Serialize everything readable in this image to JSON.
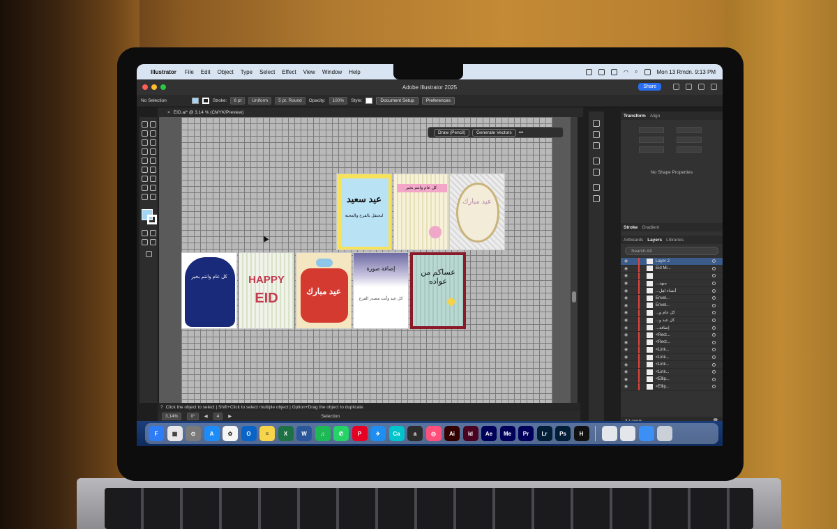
{
  "menubar": {
    "app_name": "Illustrator",
    "menus": [
      "File",
      "Edit",
      "Object",
      "Type",
      "Select",
      "Effect",
      "View",
      "Window",
      "Help"
    ],
    "datetime": "Mon 13 Rmdn. 9:13 PM"
  },
  "window": {
    "title": "Adobe Illustrator 2025",
    "share_label": "Share"
  },
  "control_bar": {
    "selection": "No Selection",
    "stroke_label": "Stroke:",
    "stroke_value": "6 pt",
    "profile": "Uniform",
    "brush": "5 pt. Round",
    "opacity_label": "Opacity:",
    "opacity_value": "100%",
    "style_label": "Style:",
    "document_setup": "Document Setup",
    "preferences": "Preferences",
    "fill_color": "#a3d4f3"
  },
  "document_tab": "EID.ai* @ 3.14 % (CMYK/Preview)",
  "context_bar": {
    "draw": "Draw (Pencil)",
    "generate": "Generate Vectors",
    "more": "•••"
  },
  "cards": {
    "c1": "عيد سعيد",
    "c1_sub": "لنحتفل بالفرح والمحبة",
    "c2": "كل عام وانتم بخير",
    "c3": "عيد مبارك",
    "c4": "كل عام وانتم بخير",
    "c5_line1": "HAPPY",
    "c5_line2": "EID",
    "c6": "عيد مبارك",
    "c7": "إضافة صورة",
    "c7_sub": "كل عيد وأنت مصدر الفرح",
    "c8": "عساكم من عواده"
  },
  "hint": "Click the object to select | Shift+Click to select multiple object | Option+Drag the object to duplicate",
  "status": {
    "zoom": "3.14%",
    "rotation": "0°",
    "artboard": "4",
    "mode": "Selection"
  },
  "right_panel": {
    "tabs_top": [
      "Transform",
      "Align"
    ],
    "no_shape": "No Shape Properties",
    "tabs_mid": [
      "Stroke",
      "Gradient"
    ],
    "tabs_layers": [
      "Artboards",
      "Layers",
      "Libraries"
    ],
    "search_placeholder": "Search All",
    "layers": [
      "Layer 2",
      "Eid Mi...",
      "",
      "...مبهد",
      "...أنشاء اهل",
      "Envel...",
      "Envel...",
      "...كل عام و",
      "...كل عيد و",
      "...إضافة",
      "<Rect...",
      "<Rect...",
      "<Link...",
      "<Link...",
      "<Link...",
      "<Link...",
      "<Ellip...",
      "<Ellip..."
    ],
    "footer": "3 Layers"
  },
  "dock": {
    "apps": [
      {
        "label": "F",
        "color": "#2e7cf6"
      },
      {
        "label": "▦",
        "color": "#e8e8ea"
      },
      {
        "label": "⊙",
        "color": "#7a7a7a"
      },
      {
        "label": "A",
        "color": "#1d8cf8"
      },
      {
        "label": "✿",
        "color": "#f5f5f5"
      },
      {
        "label": "O",
        "color": "#0a64c8"
      },
      {
        "label": "≡",
        "color": "#f7d54a"
      },
      {
        "label": "X",
        "color": "#1e7145"
      },
      {
        "label": "W",
        "color": "#2b579a"
      },
      {
        "label": "♫",
        "color": "#1db954"
      },
      {
        "label": "✆",
        "color": "#25d366"
      },
      {
        "label": "P",
        "color": "#e60023"
      },
      {
        "label": "✈",
        "color": "#1f8ef1"
      },
      {
        "label": "Ca",
        "color": "#00c4cc"
      },
      {
        "label": "a",
        "color": "#2d2d2d"
      },
      {
        "label": "◎",
        "color": "#ff4f7b"
      },
      {
        "label": "Ai",
        "color": "#330000"
      },
      {
        "label": "Id",
        "color": "#49021f"
      },
      {
        "label": "Ae",
        "color": "#00005b"
      },
      {
        "label": "Me",
        "color": "#00005b"
      },
      {
        "label": "Pr",
        "color": "#00005b"
      },
      {
        "label": "Lr",
        "color": "#001e36"
      },
      {
        "label": "Ps",
        "color": "#001e36"
      },
      {
        "label": "H",
        "color": "#111111"
      }
    ]
  }
}
